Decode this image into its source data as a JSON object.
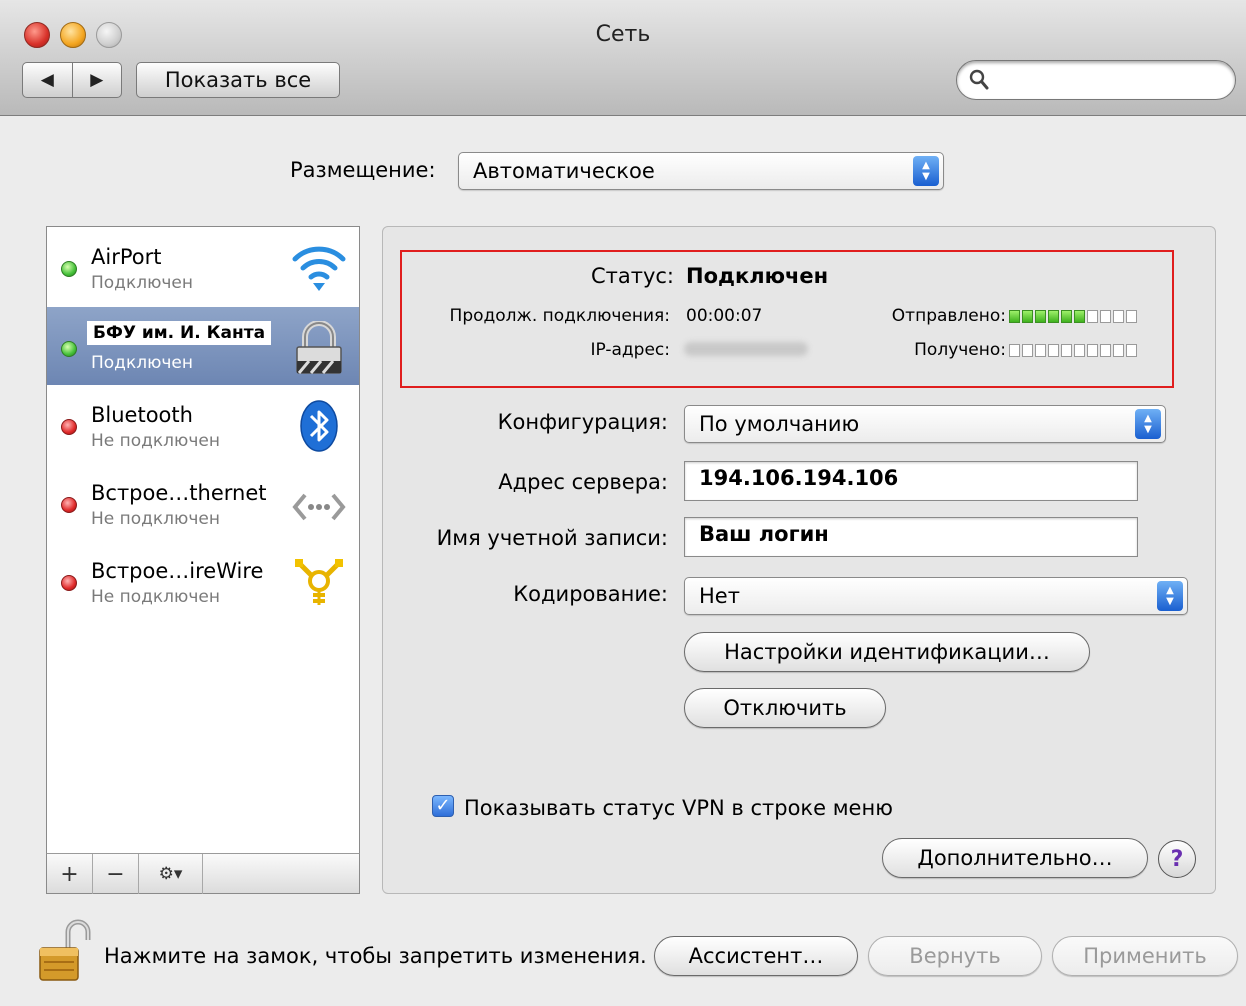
{
  "window": {
    "title": "Сеть"
  },
  "toolbar": {
    "back": "◀",
    "forward": "▶",
    "show_all": "Показать все",
    "search_placeholder": ""
  },
  "location": {
    "label": "Размещение:",
    "value": "Автоматическое"
  },
  "services": [
    {
      "name": "AirPort",
      "status": "Подключен",
      "state": "connected",
      "icon": "wifi-icon"
    },
    {
      "name": "БФУ им. И. Канта",
      "status": "Подключен",
      "state": "connected",
      "icon": "vpn-lock-icon",
      "selected": true
    },
    {
      "name": "Bluetooth",
      "status": "Не подключен",
      "state": "disconnected",
      "icon": "bluetooth-icon"
    },
    {
      "name": "Встрое…thernet",
      "status": "Не подключен",
      "state": "disconnected",
      "icon": "ethernet-icon"
    },
    {
      "name": "Встрое…ireWire",
      "status": "Не подключен",
      "state": "disconnected",
      "icon": "firewire-icon"
    }
  ],
  "list_bar": {
    "add": "+",
    "remove": "−",
    "gear": "⚙▾"
  },
  "status": {
    "label": "Статус:",
    "value": "Подключен",
    "duration_label": "Продолж. подключения:",
    "duration_value": "00:00:07",
    "ip_label": "IP-адрес:",
    "sent_label": "Отправлено:",
    "sent_level": 0.6,
    "received_label": "Получено:",
    "received_level": 0.0
  },
  "form": {
    "config_label": "Конфигурация:",
    "config_value": "По умолчанию",
    "server_label": "Адрес сервера:",
    "server_value": "194.106.194.106",
    "account_label": "Имя учетной записи:",
    "account_value": "Ваш логин",
    "encryption_label": "Кодирование:",
    "encryption_value": "Нет"
  },
  "buttons": {
    "auth_settings": "Настройки идентификации…",
    "disconnect": "Отключить",
    "advanced": "Дополнительно…",
    "help": "?",
    "assistant": "Ассистент…",
    "revert": "Вернуть",
    "apply": "Применить"
  },
  "vpn_menu_checkbox": {
    "label": "Показывать статус VPN в строке меню",
    "checked": true
  },
  "footer": {
    "lock_text": "Нажмите на замок, чтобы запретить изменения."
  },
  "colors": {
    "highlight_red": "#e01e1e",
    "selection": "#7890bb",
    "meter_green": "#3fb21d"
  }
}
